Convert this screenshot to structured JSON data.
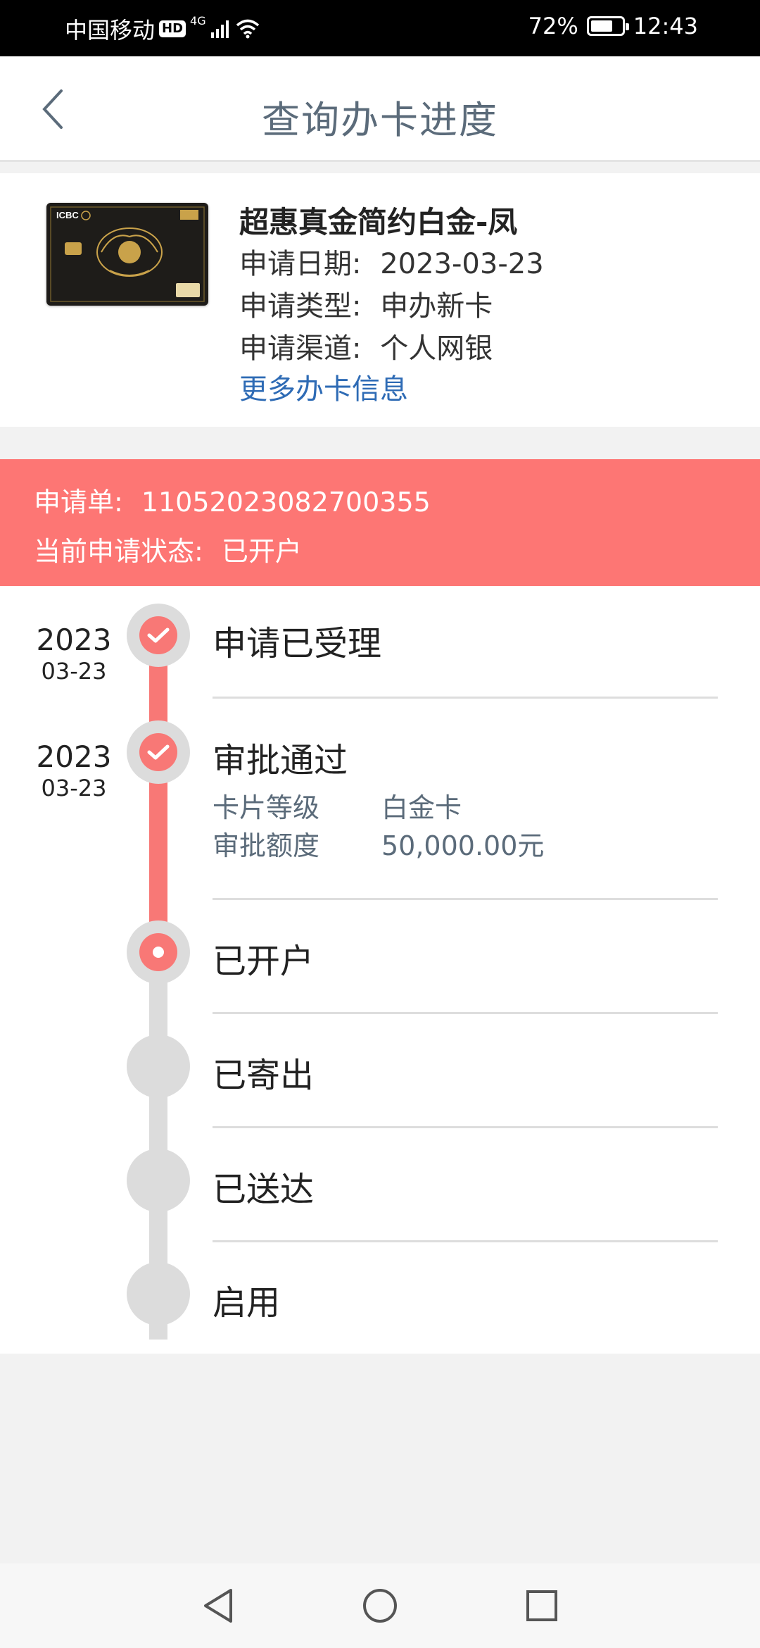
{
  "status_bar": {
    "carrier": "中国移动",
    "hd_badge": "HD",
    "network": "4G",
    "battery_text": "72%",
    "battery_level": 0.72,
    "time": "12:43"
  },
  "header": {
    "title": "查询办卡进度",
    "back_icon": "chevron-left-icon"
  },
  "card": {
    "name": "超惠真金简约白金-凤",
    "date_label": "申请日期:",
    "date_value": "2023-03-23",
    "type_label": "申请类型:",
    "type_value": "申办新卡",
    "channel_label": "申请渠道:",
    "channel_value": "个人网银",
    "more_link": "更多办卡信息",
    "image_text": "ICBC"
  },
  "application": {
    "order_label": "申请单:",
    "order_value": "11052023082700355",
    "status_label": "当前申请状态:",
    "status_value": "已开户"
  },
  "timeline": {
    "steps": [
      {
        "title": "申请已受理",
        "year": "2023",
        "md": "03-23",
        "state": "done"
      },
      {
        "title": "审批通过",
        "year": "2023",
        "md": "03-23",
        "state": "done",
        "details": [
          {
            "label": "卡片等级",
            "value": "白金卡"
          },
          {
            "label": "审批额度",
            "value": "50,000.00元"
          }
        ]
      },
      {
        "title": "已开户",
        "state": "current"
      },
      {
        "title": "已寄出",
        "state": "pending"
      },
      {
        "title": "已送达",
        "state": "pending"
      },
      {
        "title": "启用",
        "state": "pending"
      }
    ]
  },
  "colors": {
    "accent": "#f87876",
    "banner": "#fd7674",
    "link": "#2e6bb5",
    "title": "#5b6b7a"
  },
  "nav": {
    "back_icon": "triangle-back-icon",
    "home_icon": "circle-home-icon",
    "recent_icon": "square-recent-icon"
  }
}
